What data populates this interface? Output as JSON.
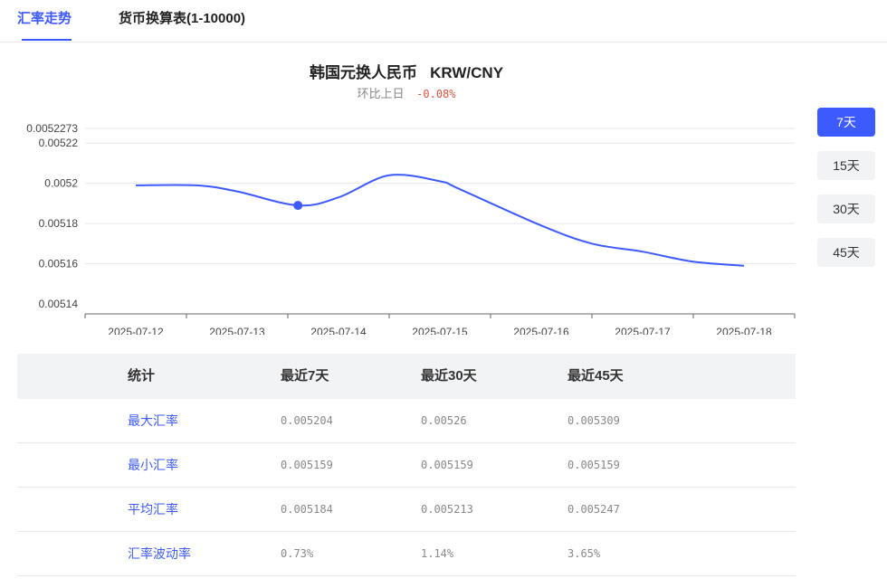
{
  "tabs": [
    {
      "label": "汇率走势",
      "active": true
    },
    {
      "label": "货币换算表(1-10000)",
      "active": false
    }
  ],
  "header": {
    "title": "韩国元换人民币   KRW/CNY",
    "change_label": "环比上日",
    "change_value": "-0.08%"
  },
  "colors": {
    "accent": "#3d5afe",
    "negative": "#e0533f"
  },
  "range_buttons": [
    "7天",
    "15天",
    "30天",
    "45天"
  ],
  "active_range": "7天",
  "chart_data": {
    "type": "line",
    "categories": [
      "2025-07-12",
      "2025-07-13",
      "2025-07-14",
      "2025-07-15",
      "2025-07-16",
      "2025-07-17",
      "2025-07-18"
    ],
    "x": [
      0,
      0.6,
      1,
      1.6,
      2,
      2.5,
      3,
      3.2,
      4,
      4.5,
      5,
      5.5,
      6
    ],
    "values": [
      0.005199,
      0.005199,
      0.005196,
      0.005189,
      0.005193,
      0.005204,
      0.005201,
      0.005197,
      0.005179,
      0.00517,
      0.005166,
      0.005161,
      0.005159
    ],
    "highlight_index": 3,
    "y_ticks": [
      "0.00514",
      "0.00516",
      "0.00518",
      "0.0052",
      "0.00522",
      "0.0052273"
    ],
    "y_tick_values": [
      0.00514,
      0.00516,
      0.00518,
      0.0052,
      0.00522,
      0.0052273
    ],
    "ylim": [
      0.00514,
      0.0052273
    ],
    "grid": true,
    "line_color": "#3d5afe"
  },
  "stats": {
    "headers": [
      "统计",
      "最近7天",
      "最近30天",
      "最近45天"
    ],
    "rows": [
      {
        "name": "最大汇率",
        "values": [
          "0.005204",
          "0.00526",
          "0.005309"
        ]
      },
      {
        "name": "最小汇率",
        "values": [
          "0.005159",
          "0.005159",
          "0.005159"
        ]
      },
      {
        "name": "平均汇率",
        "values": [
          "0.005184",
          "0.005213",
          "0.005247"
        ]
      },
      {
        "name": "汇率波动率",
        "values": [
          "0.73%",
          "1.14%",
          "3.65%"
        ]
      }
    ]
  }
}
